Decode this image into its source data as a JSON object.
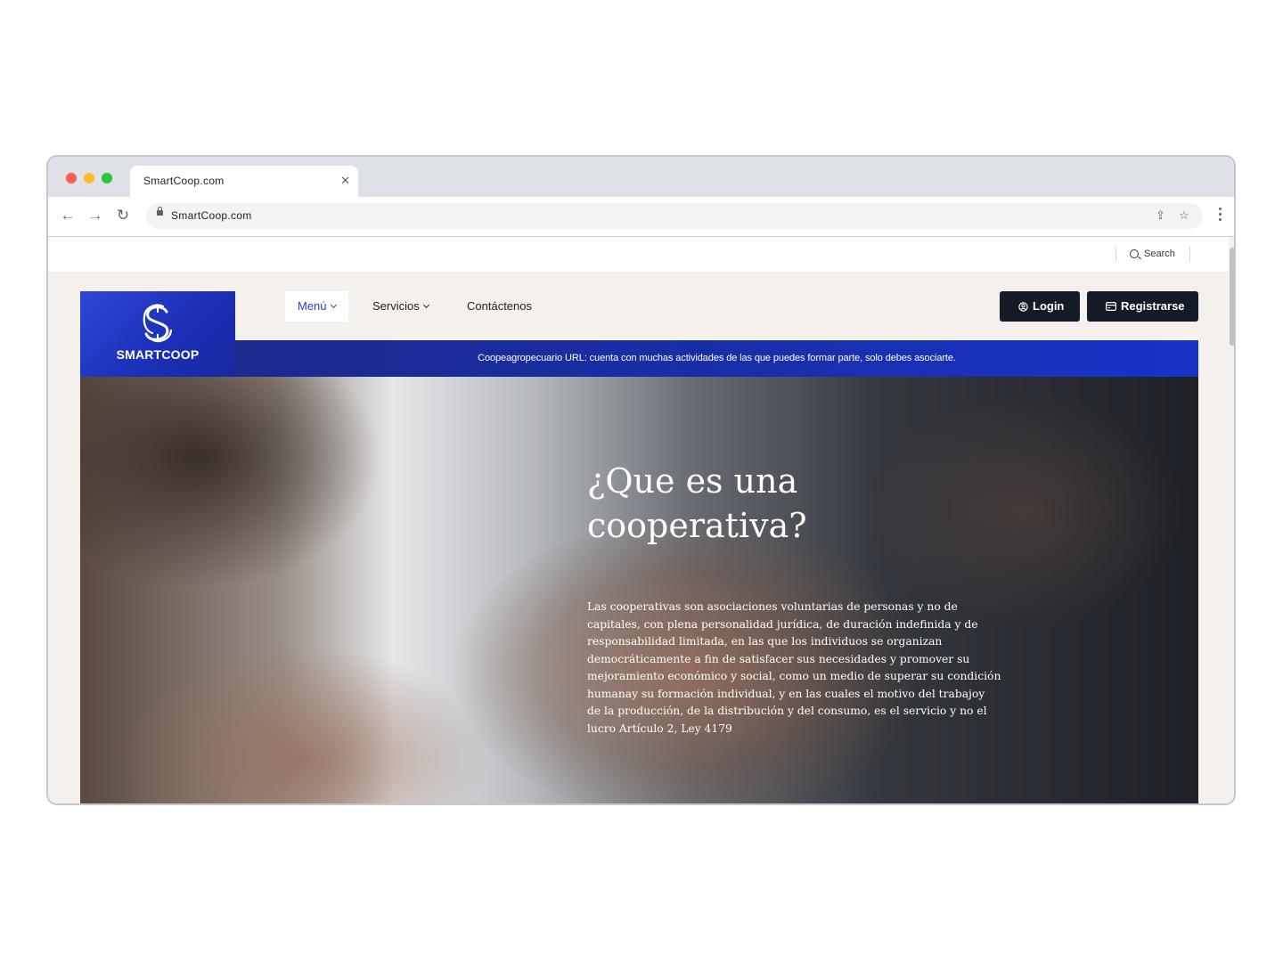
{
  "browser": {
    "tab_title": "SmartCoop.com",
    "url": "SmartCoop.com"
  },
  "site": {
    "search_label": "Search",
    "logo_text": "SMARTCOOP",
    "nav": [
      {
        "label": "Menú"
      },
      {
        "label": "Servicios"
      },
      {
        "label": "Contáctenos"
      }
    ],
    "login_label": "Login",
    "register_label": "Registrarse",
    "banner_text": "Coopeagropecuario URL: cuenta con muchas actividades de las que puedes formar parte, solo debes asociarte.",
    "hero": {
      "title": "¿Que es una cooperativa?",
      "body": "Las cooperativas son asociaciones voluntarias de personas y no de capitales, con plena personalidad jurídica, de duración indefinida y de responsabilidad limitada, en las que los individuos se organizan democráticamente a fin de satisfacer sus necesidades y promover su mejoramiento económico y social, como un medio de superar su condición humanay su formación individual, y en las cuales el motivo del trabajoy de la producción, de la distribución y del consumo, es el servicio y no el lucro Artículo 2, Ley 4179"
    }
  },
  "colors": {
    "brand_blue": "#1a2fb5",
    "button_dark": "#141a26",
    "page_bg": "#f4f0ec",
    "active_link": "#2742c7"
  },
  "icons": [
    "close-icon",
    "back-arrow-icon",
    "forward-arrow-icon",
    "reload-icon",
    "lock-icon",
    "share-icon",
    "star-icon",
    "more-vertical-icon",
    "search-icon",
    "user-icon",
    "card-icon",
    "chevron-down-icon"
  ]
}
